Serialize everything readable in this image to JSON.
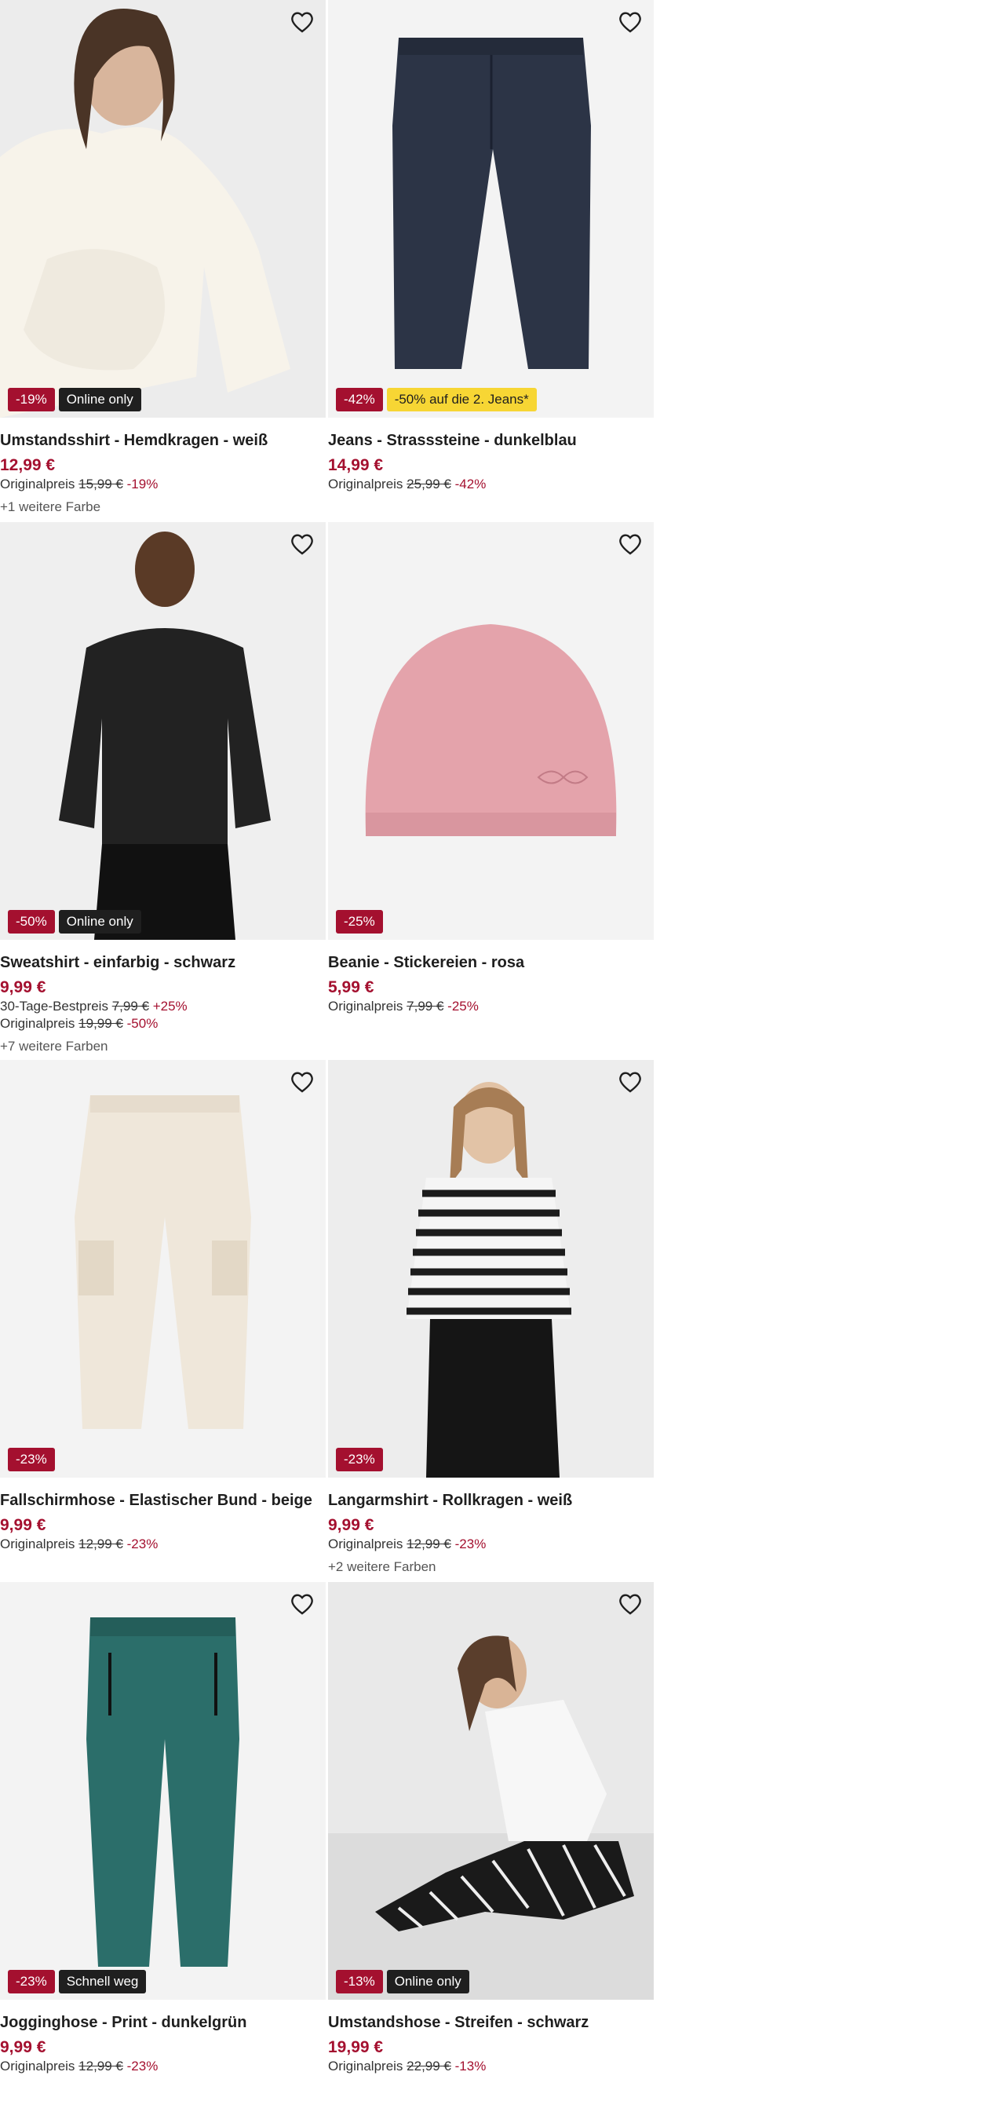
{
  "products": [
    {
      "title": "Umstandsshirt - Hemdkragen - weiß",
      "price": "12,99 €",
      "badges": [
        {
          "text": "-19%",
          "style": "red"
        },
        {
          "text": "Online only",
          "style": "dark"
        }
      ],
      "ref_label": "Originalpreis",
      "ref_price": "15,99 €",
      "ref_pct": "-19%",
      "colors": "+1 weitere Farbe"
    },
    {
      "title": "Jeans - Strasssteine - dunkelblau",
      "price": "14,99 €",
      "badges": [
        {
          "text": "-42%",
          "style": "red"
        },
        {
          "text": "-50% auf die 2. Jeans*",
          "style": "yellow"
        }
      ],
      "ref_label": "Originalpreis",
      "ref_price": "25,99 €",
      "ref_pct": "-42%"
    },
    {
      "title": "Sweatshirt - einfarbig - schwarz",
      "price": "9,99 €",
      "badges": [
        {
          "text": "-50%",
          "style": "red"
        },
        {
          "text": "Online only",
          "style": "dark"
        }
      ],
      "best_label": "30-Tage-Bestpreis",
      "best_price": "7,99 €",
      "best_pct": "+25%",
      "ref_label": "Originalpreis",
      "ref_price": "19,99 €",
      "ref_pct": "-50%",
      "colors": "+7 weitere Farben"
    },
    {
      "title": "Beanie - Stickereien - rosa",
      "price": "5,99 €",
      "badges": [
        {
          "text": "-25%",
          "style": "red"
        }
      ],
      "ref_label": "Originalpreis",
      "ref_price": "7,99 €",
      "ref_pct": "-25%"
    },
    {
      "title": "Fallschirmhose - Elastischer Bund - beige",
      "price": "9,99 €",
      "badges": [
        {
          "text": "-23%",
          "style": "red"
        }
      ],
      "ref_label": "Originalpreis",
      "ref_price": "12,99 €",
      "ref_pct": "-23%"
    },
    {
      "title": "Langarmshirt - Rollkragen - weiß",
      "price": "9,99 €",
      "badges": [
        {
          "text": "-23%",
          "style": "red"
        }
      ],
      "ref_label": "Originalpreis",
      "ref_price": "12,99 €",
      "ref_pct": "-23%",
      "colors": "+2 weitere Farben"
    },
    {
      "title": "Jogginghose - Print - dunkelgrün",
      "price": "9,99 €",
      "badges": [
        {
          "text": "-23%",
          "style": "red"
        },
        {
          "text": "Schnell weg",
          "style": "dark"
        }
      ],
      "ref_label": "Originalpreis",
      "ref_price": "12,99 €",
      "ref_pct": "-23%"
    },
    {
      "title": "Umstandshose - Streifen - schwarz",
      "price": "19,99 €",
      "badges": [
        {
          "text": "-13%",
          "style": "red"
        },
        {
          "text": "Online only",
          "style": "dark"
        }
      ],
      "ref_label": "Originalpreis",
      "ref_price": "22,99 €",
      "ref_pct": "-13%"
    }
  ],
  "icons": {
    "wishlist": "heart-outline-icon"
  },
  "colors": {
    "accent": "#a4102f",
    "badge_dark": "#1f1f1f",
    "badge_yellow": "#f7d634"
  }
}
